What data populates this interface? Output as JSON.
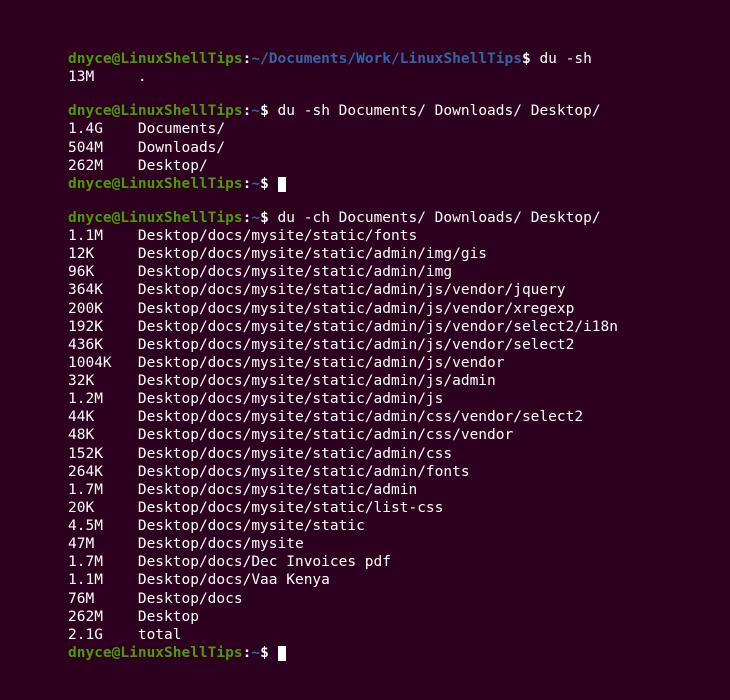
{
  "user_host": "dnyce@LinuxShellTips",
  "block1": {
    "path": "~/Documents/Work/LinuxShellTips",
    "cmd": "du -sh",
    "output": [
      "13M     ."
    ]
  },
  "block2": {
    "path": "~",
    "cmd": "du -sh Documents/ Downloads/ Desktop/",
    "output": [
      "1.4G    Documents/",
      "504M    Downloads/",
      "262M    Desktop/"
    ]
  },
  "block3": {
    "path": "~",
    "cmd": "du -ch Documents/ Downloads/ Desktop/",
    "output": [
      "1.1M    Desktop/docs/mysite/static/fonts",
      "12K     Desktop/docs/mysite/static/admin/img/gis",
      "96K     Desktop/docs/mysite/static/admin/img",
      "364K    Desktop/docs/mysite/static/admin/js/vendor/jquery",
      "200K    Desktop/docs/mysite/static/admin/js/vendor/xregexp",
      "192K    Desktop/docs/mysite/static/admin/js/vendor/select2/i18n",
      "436K    Desktop/docs/mysite/static/admin/js/vendor/select2",
      "1004K   Desktop/docs/mysite/static/admin/js/vendor",
      "32K     Desktop/docs/mysite/static/admin/js/admin",
      "1.2M    Desktop/docs/mysite/static/admin/js",
      "44K     Desktop/docs/mysite/static/admin/css/vendor/select2",
      "48K     Desktop/docs/mysite/static/admin/css/vendor",
      "152K    Desktop/docs/mysite/static/admin/css",
      "264K    Desktop/docs/mysite/static/admin/fonts",
      "1.7M    Desktop/docs/mysite/static/admin",
      "20K     Desktop/docs/mysite/static/list-css",
      "4.5M    Desktop/docs/mysite/static",
      "47M     Desktop/docs/mysite",
      "1.7M    Desktop/docs/Dec Invoices pdf",
      "1.1M    Desktop/docs/Vaa Kenya",
      "76M     Desktop/docs",
      "262M    Desktop",
      "2.1G    total"
    ]
  }
}
